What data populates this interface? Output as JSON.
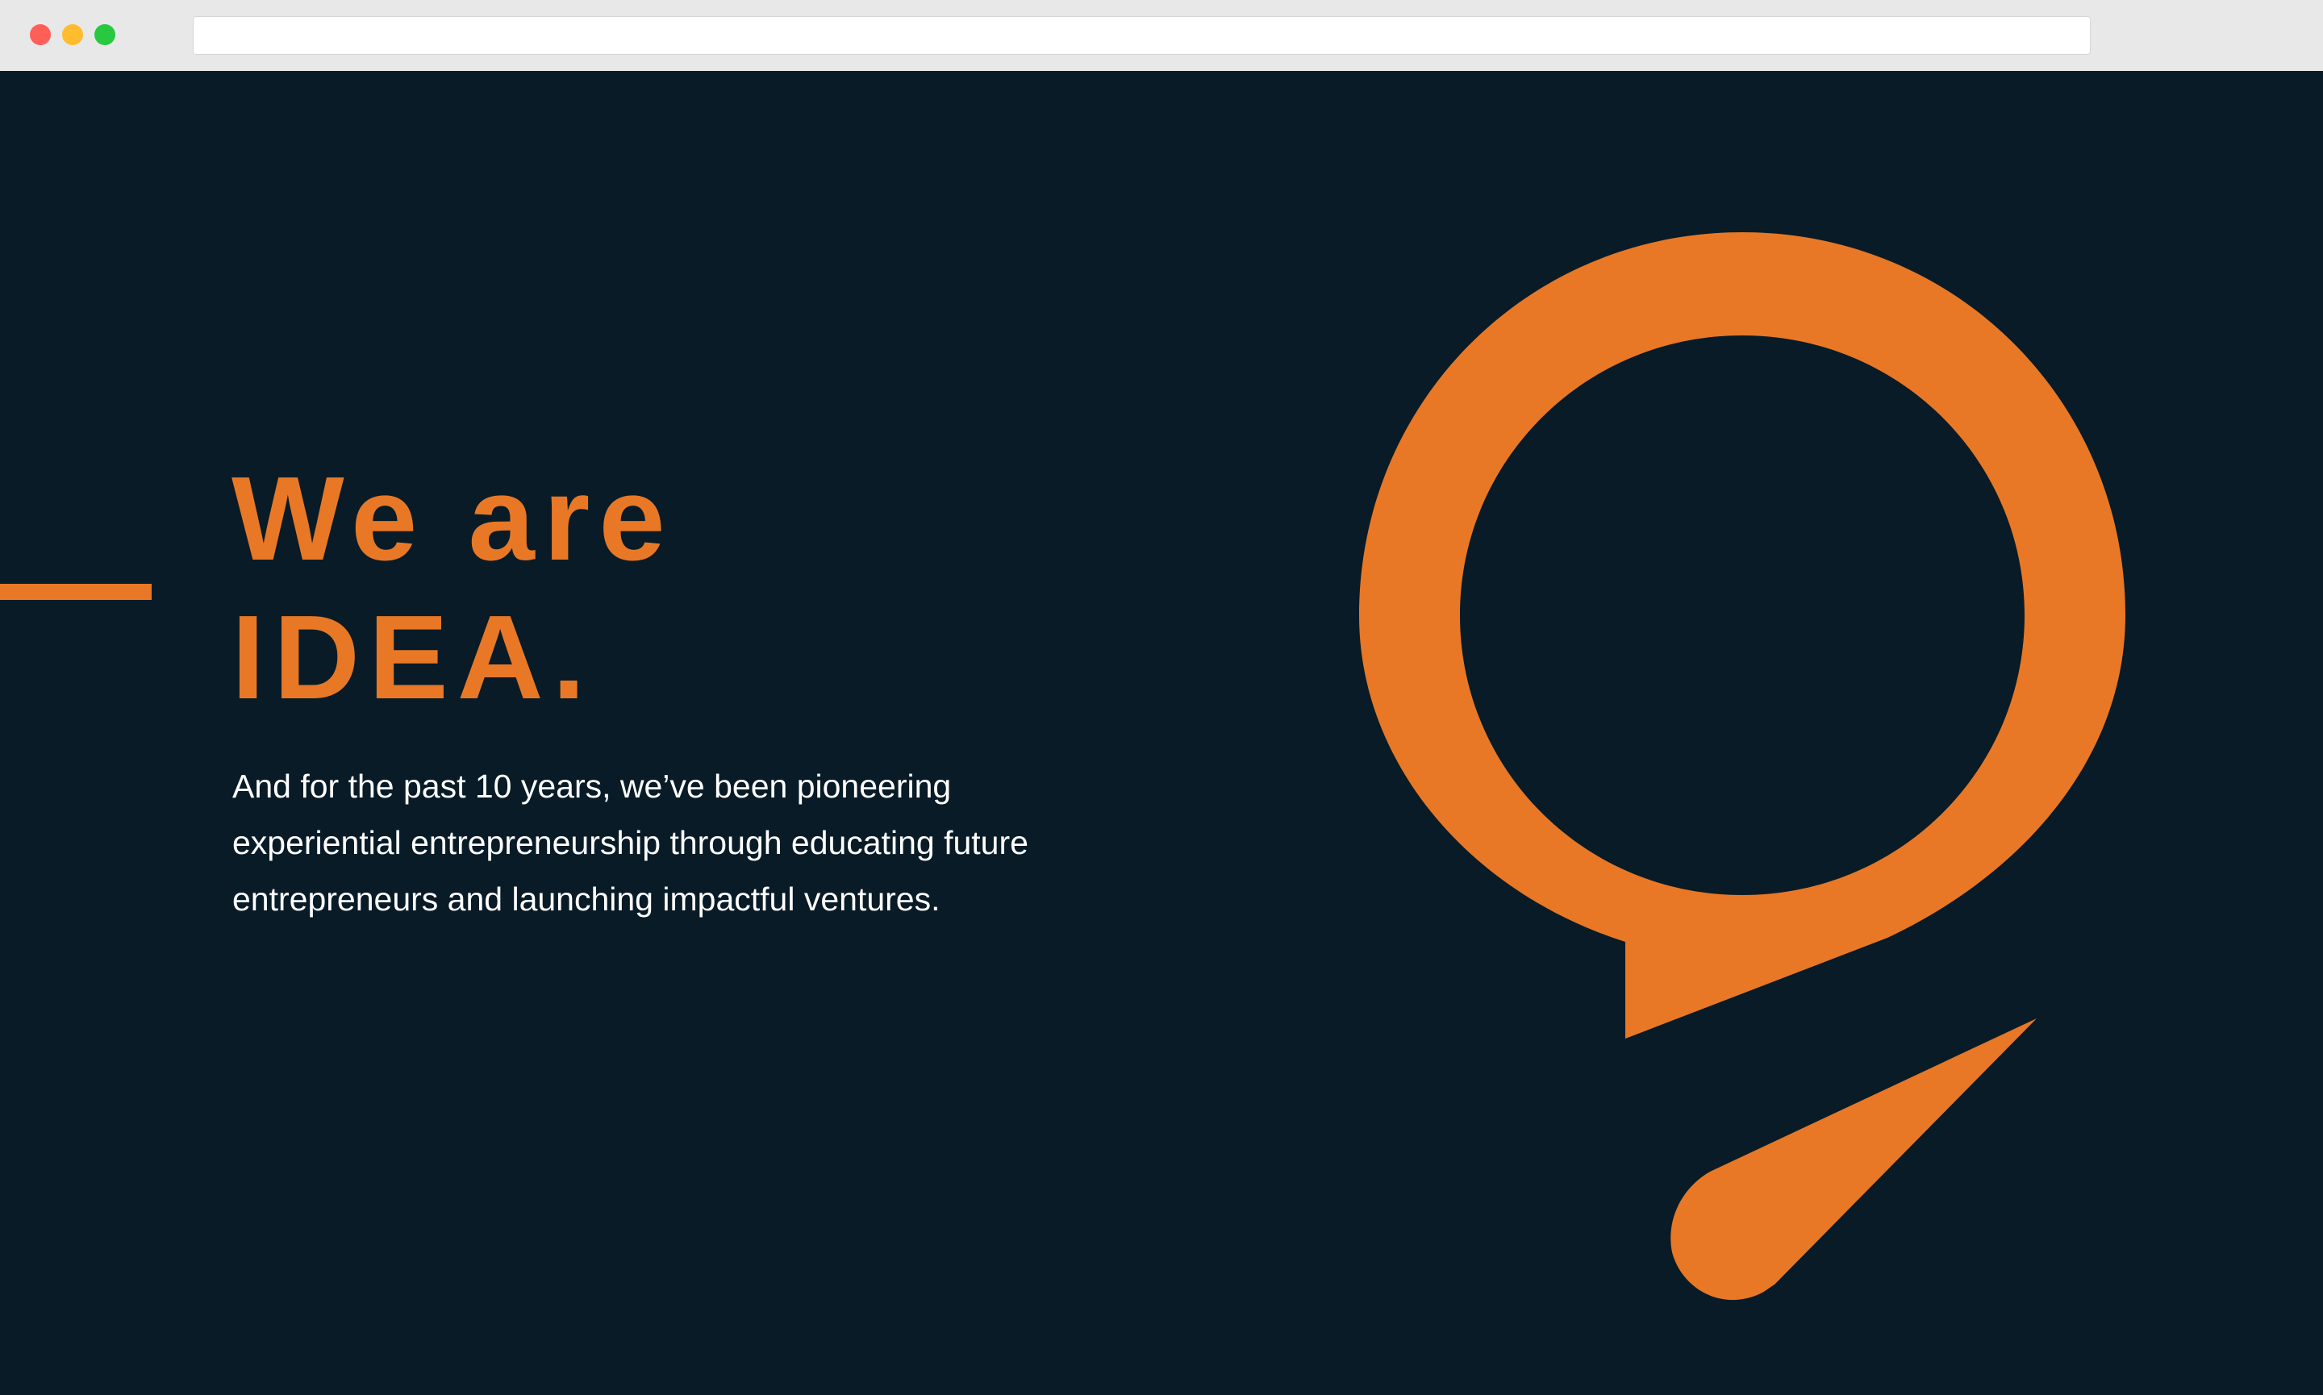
{
  "browser": {
    "traffic_lights": {
      "close": "#ff5f57",
      "minimize": "#febc2e",
      "maximize": "#28c840"
    },
    "address_bar": {
      "value": ""
    }
  },
  "colors": {
    "background": "#081b27",
    "accent": "#e87826",
    "text": "#ffffff"
  },
  "hero": {
    "headline_line1": "We are",
    "headline_line2": "IDEA.",
    "body": "And for the past 10 years, we’ve been pioneering experiential entrepreneurship through educating future entrepreneurs and launching impactful ventures.",
    "logo_icon": "idea-speech-bubble-logo-icon"
  }
}
